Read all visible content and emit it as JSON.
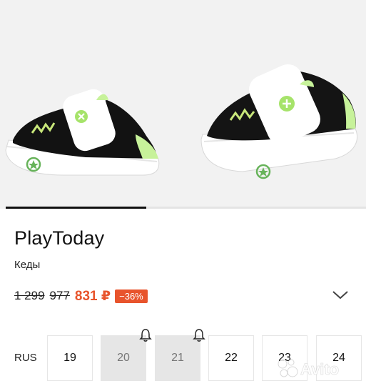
{
  "gallery": {
    "progress": 0.39
  },
  "product": {
    "brand": "PlayToday",
    "category": "Кеды",
    "price_original": "1 299",
    "price_previous": "977",
    "price_current": "831 ₽",
    "discount": "−36%"
  },
  "sizes": {
    "label": "RUS",
    "items": [
      {
        "value": "19",
        "available": true
      },
      {
        "value": "20",
        "available": false
      },
      {
        "value": "21",
        "available": false
      },
      {
        "value": "22",
        "available": true
      },
      {
        "value": "23",
        "available": true
      },
      {
        "value": "24",
        "available": true
      }
    ]
  },
  "icons": {
    "expand": "chevron-down-icon",
    "notify": "bell-icon",
    "logo": "avito-logo-icon"
  },
  "colors": {
    "accent": "#e8542c",
    "shoe_green": "#b9ef7e"
  },
  "watermark": {
    "text": "Avito"
  }
}
